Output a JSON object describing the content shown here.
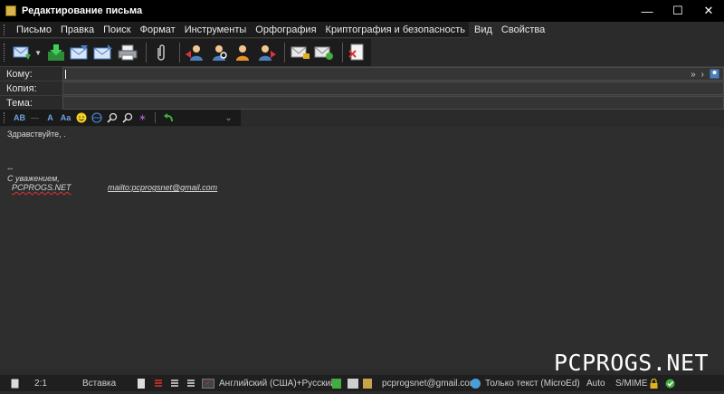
{
  "window": {
    "title": "Редактирование письма",
    "minimize": "—",
    "maximize": "☐",
    "close": "✕"
  },
  "menu": [
    "Письмо",
    "Правка",
    "Поиск",
    "Формат",
    "Инструменты",
    "Орфография",
    "Криптография и безопасность",
    "Вид",
    "Свойства"
  ],
  "toolbar": {
    "icons": [
      "send-icon",
      "save-download-icon",
      "inbox-icon",
      "outbox-icon",
      "print-icon",
      "attach-icon",
      "address-book-left-icon",
      "address-book-search-icon",
      "address-book-person-icon",
      "address-book-right-icon",
      "encrypt-mail-icon",
      "sign-mail-icon",
      "close-document-icon"
    ]
  },
  "fields": {
    "to_label": "Кому:",
    "to_value": "",
    "cc_label": "Копия:",
    "cc_value": "",
    "subject_label": "Тема:",
    "subject_value": ""
  },
  "format_toolbar": {
    "bold_label": "AB",
    "color_label": "A",
    "font_label": "Aa"
  },
  "editor": {
    "greeting": "Здравствуйте, .",
    "sig_dash": "--",
    "sig_regards": "С уважением,",
    "sig_name": "PCPROGS.NET",
    "sig_link": "mailto:pcprogsnet@gmail.com"
  },
  "statusbar": {
    "position": "2:1",
    "mode": "Вставка",
    "language": "Английский (США)+Русский",
    "account": "pcprogsnet@gmail.com",
    "text_mode": "Только текст (MicroEd)",
    "auto": "Auto",
    "smime": "S/MIME"
  },
  "watermark": "PCPROGS.NET",
  "colors": {
    "background": "#2b2b2b",
    "titlebar": "#000000",
    "link": "#4a8fe0",
    "accent_green": "#3fae3f"
  }
}
